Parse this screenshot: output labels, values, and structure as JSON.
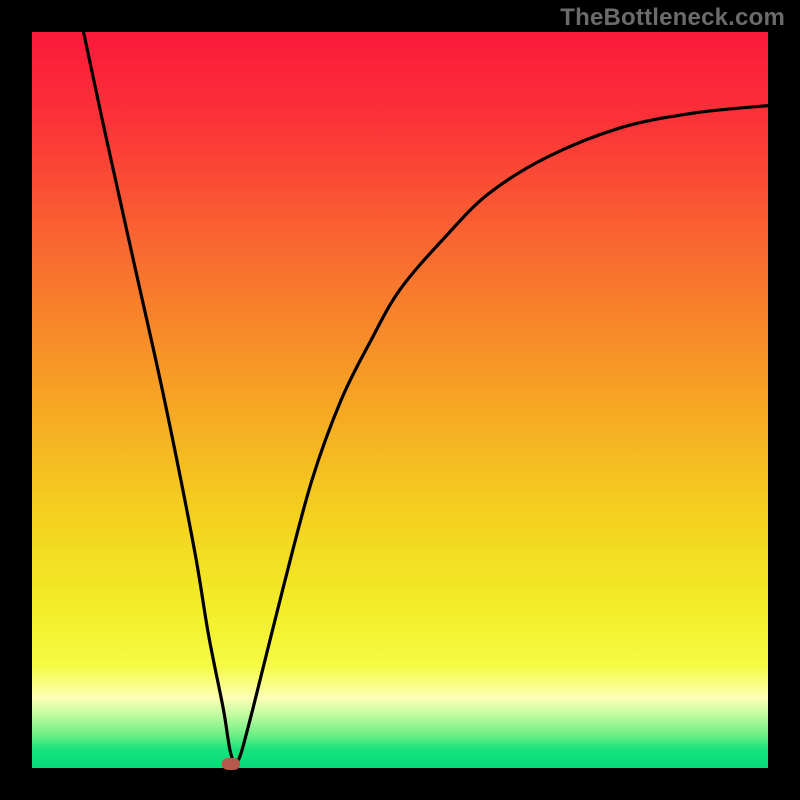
{
  "watermark": "TheBottleneck.com",
  "chart_data": {
    "type": "line",
    "title": "",
    "xlabel": "",
    "ylabel": "",
    "x_range": [
      0,
      100
    ],
    "y_range": [
      0,
      100
    ],
    "series": [
      {
        "name": "curve",
        "x": [
          7,
          10,
          14,
          18,
          22,
          24,
          26,
          27,
          28,
          30,
          34,
          38,
          42,
          46,
          50,
          56,
          62,
          70,
          80,
          90,
          100
        ],
        "y": [
          100,
          86,
          68,
          50,
          30,
          18,
          8,
          2,
          1,
          8,
          24,
          39,
          50,
          58,
          65,
          72,
          78,
          83,
          87,
          89,
          90
        ]
      }
    ],
    "marker": {
      "x": 27,
      "y": 0.5
    },
    "background_gradient": {
      "stops": [
        {
          "pos": 0.0,
          "color": "#fb193a"
        },
        {
          "pos": 0.12,
          "color": "#fb3238"
        },
        {
          "pos": 0.3,
          "color": "#f96b30"
        },
        {
          "pos": 0.5,
          "color": "#f6a423"
        },
        {
          "pos": 0.65,
          "color": "#f4cf1f"
        },
        {
          "pos": 0.78,
          "color": "#f2ed26"
        },
        {
          "pos": 0.86,
          "color": "#f5fa43"
        },
        {
          "pos": 0.905,
          "color": "#fdffb6"
        },
        {
          "pos": 0.925,
          "color": "#c9fba3"
        },
        {
          "pos": 0.955,
          "color": "#6df084"
        },
        {
          "pos": 0.975,
          "color": "#17e37c"
        },
        {
          "pos": 1.0,
          "color": "#05d977"
        }
      ]
    }
  }
}
